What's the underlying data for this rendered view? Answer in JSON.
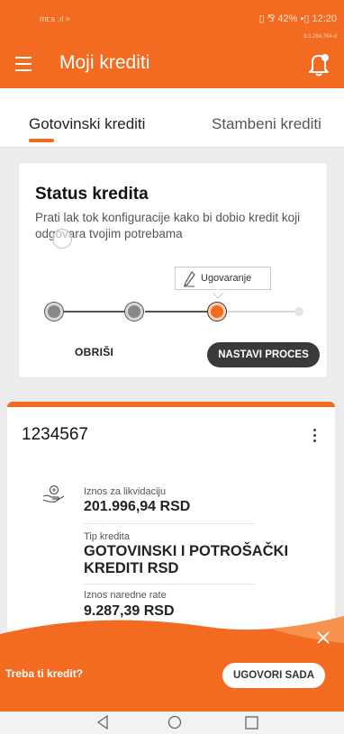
{
  "status_bar": {
    "left_text": "mt:s .ıl ≈",
    "right_text": "▯ ⅋ 42% ▪▯ 12:20",
    "small_text": "3.0.264.764-d"
  },
  "app_bar": {
    "title": "Moji krediti",
    "menu_icon": "hamburger-menu-icon",
    "bell_icon": "bell-icon"
  },
  "tabs": [
    {
      "label": "Gotovinski krediti",
      "active": true
    },
    {
      "label": "Stambeni krediti",
      "active": false
    }
  ],
  "status_card": {
    "title": "Status kredita",
    "description": "Prati lak tok konfiguracije kako bi dobio kredit koji odgovara tvojim potrebama",
    "current_step_label": "Ugovaranje",
    "steps": [
      {
        "state": "done"
      },
      {
        "state": "done"
      },
      {
        "state": "active"
      },
      {
        "state": "todo"
      }
    ],
    "delete_label": "OBRIŠI",
    "continue_label": "NASTAVI PROCES"
  },
  "loan_card": {
    "number": "1234567",
    "fields": [
      {
        "label": "Iznos za likvidaciju",
        "value": "201.996,94 RSD"
      },
      {
        "label": "Tip kredita",
        "value": "GOTOVINSKI I POTROŠAČKI KREDITI RSD"
      },
      {
        "label": "Iznos naredne rate",
        "value": "9.287,39 RSD"
      }
    ]
  },
  "banner": {
    "text": "Treba ti kredit?",
    "button_label": "UGOVORI SADA"
  },
  "colors": {
    "accent": "#f26b21",
    "dark_button": "#3a3a3a"
  }
}
